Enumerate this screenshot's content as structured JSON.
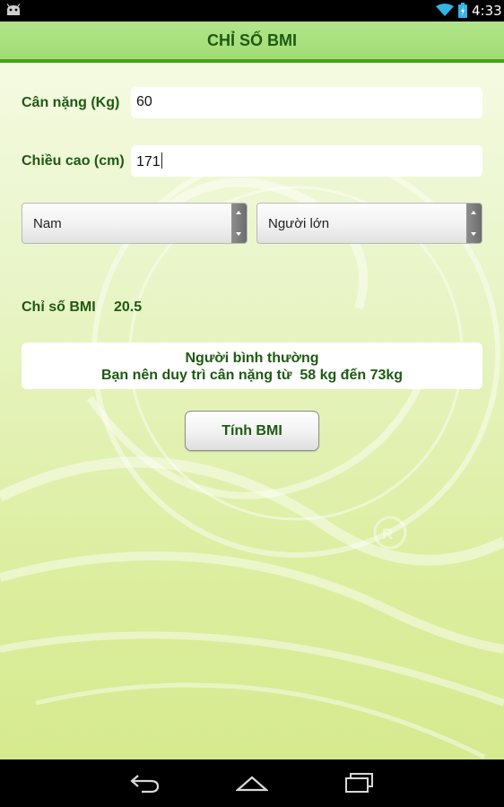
{
  "status_bar": {
    "time": "4:33",
    "icons": [
      "android-icon",
      "wifi-icon",
      "battery-icon"
    ]
  },
  "header": {
    "title": "CHỈ SỐ BMI"
  },
  "form": {
    "weight_label": "Cân nặng (Kg)",
    "weight_value": "60",
    "height_label": "Chiều cao (cm)",
    "height_value": "171",
    "gender_selected": "Nam",
    "age_group_selected": "Người lớn"
  },
  "result": {
    "bmi_label": "Chỉ số BMI",
    "bmi_value": "20.5",
    "category": "Người bình thường",
    "advice": "Bạn nên duy trì cân nặng từ  58 kg đến 73kg"
  },
  "actions": {
    "calculate_label": "Tính BMI"
  },
  "nav_bar": {
    "icons": [
      "back-icon",
      "home-icon",
      "recent-apps-icon"
    ]
  },
  "colors": {
    "title_bar": "#a1dc74",
    "title_bar_border": "#43a31b",
    "text_green": "#1e5a12",
    "background_light": "#f6fbe6",
    "background_bottom": "#d6ea8f"
  }
}
